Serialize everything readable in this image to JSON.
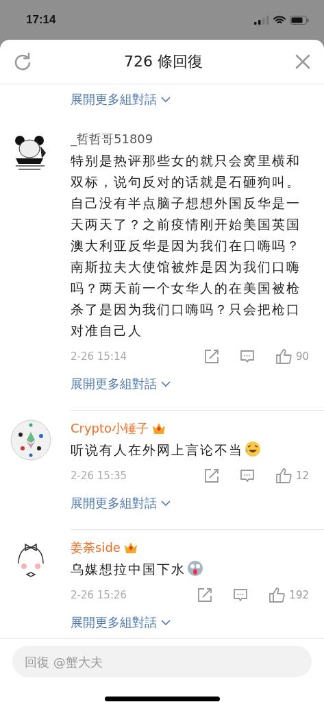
{
  "status_bar": {
    "time": "17:14"
  },
  "header": {
    "title": "726 條回復"
  },
  "top_expand": "展開更多組對話",
  "comments": [
    {
      "name": "_哲哲哥51809",
      "vip": false,
      "avatar": {
        "kind": "panda"
      },
      "body": "特别是热评那些女的就只会窝里横和双标，说句反对的话就是石砸狗叫。自己没有半点脑子想想外国反华是一天两天了？之前疫情刚开始美国英国澳大利亚反华是因为我们在口嗨吗？南斯拉夫大使馆被炸是因为我们口嗨吗？两天前一个女华人的在美国被枪杀了是因为我们口嗨吗？只会把枪口对准自己人",
      "time": "2-26 15:14",
      "likes": "90",
      "expand": "展開更多組對話"
    },
    {
      "name": "Crypto小锤子",
      "vip": true,
      "avatar": {
        "kind": "pattern"
      },
      "body": "听说有人在外网上言论不当",
      "emoji": {
        "kind": "laughing"
      },
      "time": "2-26 15:35",
      "likes": "12",
      "expand": "展開更多組對話"
    },
    {
      "name": "姜荼side",
      "vip": true,
      "avatar": {
        "kind": "girl"
      },
      "body": "乌媒想拉中国下水",
      "emoji": {
        "kind": "dizzy"
      },
      "time": "2-26 15:26",
      "likes": "192",
      "expand": "展開更多組對話"
    }
  ],
  "reply_field": {
    "placeholder": "回復 @蟹大夫"
  }
}
